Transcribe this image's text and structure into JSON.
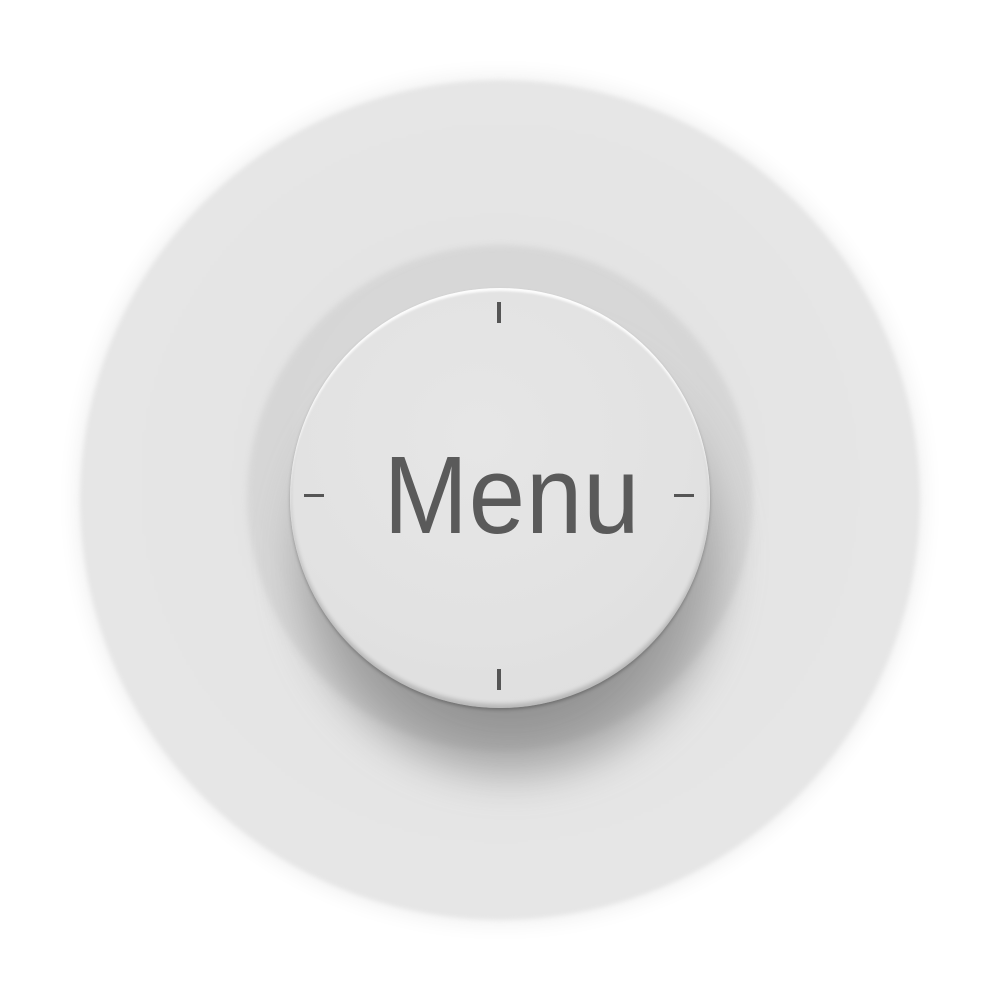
{
  "menu_knob": {
    "label": "Menu"
  },
  "colors": {
    "background": "#ffffff",
    "outer_disc": "#e4e4e4",
    "knob_face": "#e2e2e2",
    "label_text": "#5a5a5a",
    "tick_marks": "#555555"
  },
  "icons": {
    "ticks": [
      "tick-mark-top",
      "tick-mark-right",
      "tick-mark-bottom",
      "tick-mark-left"
    ]
  }
}
